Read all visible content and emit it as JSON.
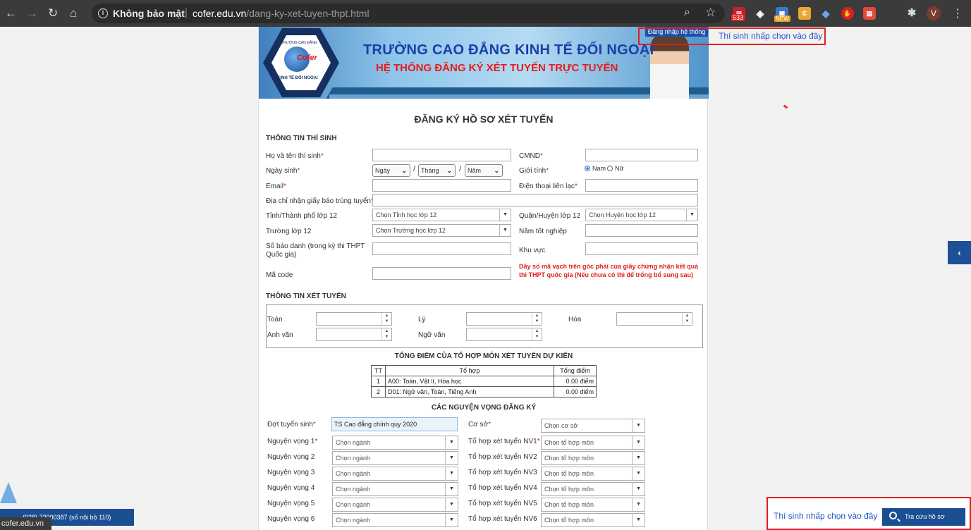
{
  "browser": {
    "security": "Không bảo mật",
    "url_host": "cofer.edu.vn",
    "url_path": "/dang-ky-xet-tuyen-thpt.html",
    "ext_badge": "533",
    "ext_new": "NEW",
    "profile": "V",
    "status_url": "cofer.edu.vn"
  },
  "banner": {
    "school": "TRƯỜNG CAO ĐẲNG KINH TẾ ĐỐI NGOẠI",
    "system": "HỆ THỐNG ĐĂNG KÝ XÉT TUYỂN TRỰC TUYẾN",
    "logo_text": "KINH TẾ ĐỐI NGOẠI",
    "logo_top": "TRƯỜNG CAO ĐẲNG",
    "logo_brand": "Cofer",
    "login": "Đăng nhập hệ thống"
  },
  "callouts": {
    "top": "Thí sinh nhấp chọn vào đây",
    "bottom": "Thí sinh nhấp chọn vào đây"
  },
  "form": {
    "title": "ĐĂNG KÝ HỒ SƠ XÉT TUYỂN",
    "section_student": "THÔNG TIN THÍ SINH",
    "fullname": "Họ và tên thí sinh",
    "id_card": "CMND",
    "dob": "Ngày sinh",
    "dob_day": "Ngày",
    "dob_month": "Tháng",
    "dob_year": "Năm",
    "gender": "Giới tính",
    "male": "Nam",
    "female": "Nữ",
    "email": "Email",
    "phone": "Điện thoại liên lạc",
    "address": "Địa chỉ nhận giấy báo trúng tuyển",
    "province": "Tỉnh/Thành phố lớp 12",
    "province_ph": "Chọn Tỉnh học lớp 12",
    "district": "Quận/Huyện lớp 12",
    "district_ph": "Chọn Huyện học lớp 12",
    "school12": "Trường lớp 12",
    "school12_ph": "Chọn Trường học lớp 12",
    "grad_year": "Năm tốt nghiệp",
    "sbd_line1": "Số báo danh (trong kỳ thi THPT",
    "sbd_line2": "Quốc gia)",
    "region": "Khu vực",
    "code": "Mã code",
    "code_note": "Dãy số mã vạch trên góc phải của giấy chứng nhận kết quả thi THPT quốc gia (Nếu chưa có thì để trống bổ sung sau)",
    "section_admission": "THÔNG TIN XÉT TUYỂN",
    "math": "Toán",
    "physics": "Lý",
    "chemistry": "Hóa",
    "english": "Anh văn",
    "literature": "Ngữ văn",
    "combo_title": "TỔNG ĐIỂM CỦA TỔ HỢP MÔN XÉT TUYỂN DỰ KIẾN",
    "combo_headers": [
      "TT",
      "Tổ hợp",
      "Tổng điểm"
    ],
    "combo_rows": [
      [
        "1",
        "A00: Toán, Vật lí, Hóa học",
        "0.00 điểm"
      ],
      [
        "2",
        "D01: Ngữ văn, Toán, Tiếng Anh",
        "0.00 điểm"
      ]
    ],
    "wishes_title": "CÁC NGUYỆN VỌNG ĐĂNG KÝ",
    "round": "Đợt tuyển sinh",
    "round_value": "TS Cao đẳng chính quy 2020",
    "campus": "Cơ sở",
    "campus_ph": "Chọn cơ sở",
    "wishes": [
      {
        "label": "Nguyện vọng 1",
        "major_ph": "Chọn ngành",
        "combo_label": "Tổ hợp xét tuyển NV1",
        "combo_ph": "Chọn tổ hợp môn"
      },
      {
        "label": "Nguyện vọng 2",
        "major_ph": "Chọn ngành",
        "combo_label": "Tổ hợp xét tuyển NV2",
        "combo_ph": "Chọn tổ hợp môn"
      },
      {
        "label": "Nguyện vọng 3",
        "major_ph": "Chọn ngành",
        "combo_label": "Tổ hợp xét tuyển NV3",
        "combo_ph": "Chọn tổ hợp môn"
      },
      {
        "label": "Nguyện vọng 4",
        "major_ph": "Chọn ngành",
        "combo_label": "Tổ hợp xét tuyển NV4",
        "combo_ph": "Chọn tổ hợp môn"
      },
      {
        "label": "Nguyện vọng 5",
        "major_ph": "Chọn ngành",
        "combo_label": "Tổ hợp xét tuyển NV5",
        "combo_ph": "Chọn tổ hợp môn"
      },
      {
        "label": "Nguyện vọng 6",
        "major_ph": "Chọn ngành",
        "combo_label": "Tổ hợp xét tuyển NV6",
        "combo_ph": "Chọn tổ hợp môn"
      }
    ]
  },
  "footer": {
    "hotline": "(028) 73000387 (số nội bộ 110)",
    "lookup": "Tra cứu hồ sơ"
  },
  "colors": {
    "primary": "#1c4f92",
    "required": "#e02020",
    "callout": "#1f56c4"
  }
}
